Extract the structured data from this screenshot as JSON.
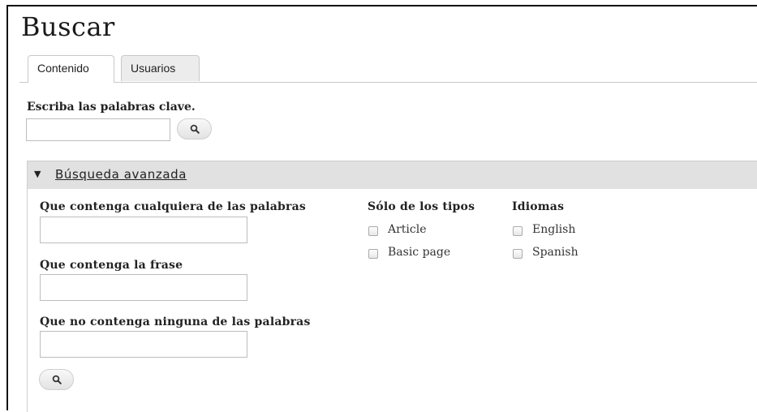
{
  "page": {
    "title": "Buscar"
  },
  "tabs": [
    {
      "label": "Contenido",
      "active": true
    },
    {
      "label": "Usuarios",
      "active": false
    }
  ],
  "keyword_search": {
    "label": "Escriba las palabras clave.",
    "value": "",
    "button_icon": "search-icon"
  },
  "advanced": {
    "toggle_label": "Búsqueda avanzada",
    "expanded": true,
    "any_words": {
      "label": "Que contenga cualquiera de las palabras",
      "value": ""
    },
    "phrase": {
      "label": "Que contenga la frase",
      "value": ""
    },
    "none_words": {
      "label": "Que no contenga ninguna de las palabras",
      "value": ""
    },
    "types": {
      "label": "Sólo de los tipos",
      "options": [
        {
          "label": "Article",
          "checked": false
        },
        {
          "label": "Basic page",
          "checked": false
        }
      ]
    },
    "languages": {
      "label": "Idiomas",
      "options": [
        {
          "label": "English",
          "checked": false
        },
        {
          "label": "Spanish",
          "checked": false
        }
      ]
    },
    "button_icon": "search-icon"
  },
  "colors": {
    "header_bar": "#e1e1e1",
    "tab_inactive": "#ececec",
    "border": "#c8c8c8"
  }
}
